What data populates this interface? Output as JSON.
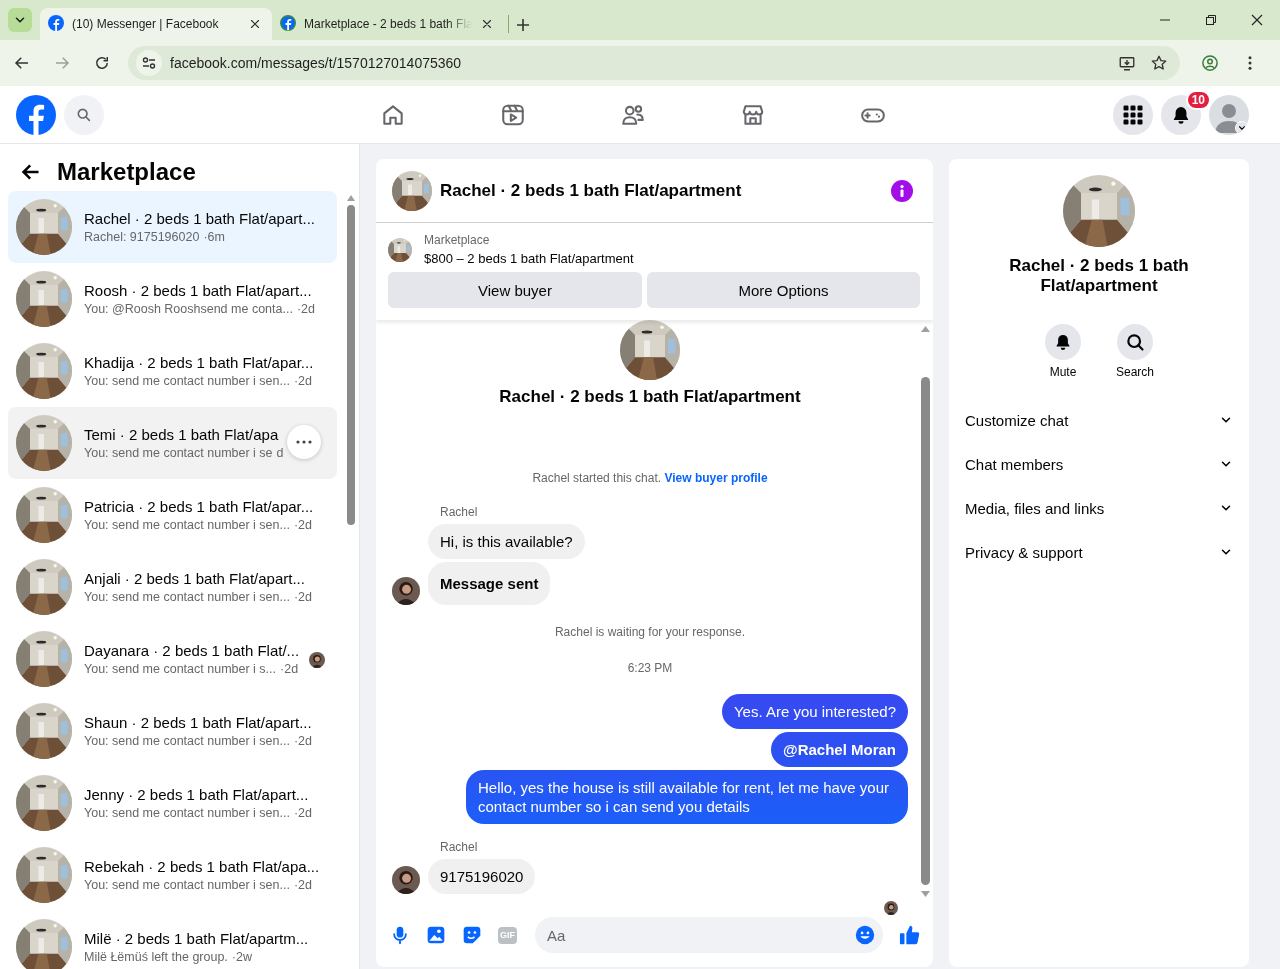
{
  "browser": {
    "tabs": [
      {
        "title": "(10) Messenger | Facebook",
        "selected": true
      },
      {
        "title": "Marketplace - 2 beds 1 bath Fla",
        "selected": false
      }
    ],
    "url": "facebook.com/messages/t/1570127014075360"
  },
  "topbar": {
    "notification_count": "10"
  },
  "sidebar": {
    "title": "Marketplace",
    "conversations": [
      {
        "name": "Rachel · 2 beds 1 bath Flat/apart...",
        "preview": "Rachel: 9175196020",
        "time": "·6m",
        "selected": true,
        "hovered": false,
        "seen": false
      },
      {
        "name": "Roosh · 2 beds 1 bath Flat/apart...",
        "preview": "You: @Roosh Rooshsend me conta...",
        "time": "·2d",
        "selected": false,
        "hovered": false,
        "seen": false
      },
      {
        "name": "Khadija · 2 beds 1 bath Flat/apar...",
        "preview": "You: send me contact number i sen...",
        "time": "·2d",
        "selected": false,
        "hovered": false,
        "seen": false
      },
      {
        "name": "Temi · 2 beds 1 bath Flat/apa",
        "preview": "You: send me contact number i se",
        "time": "d",
        "selected": false,
        "hovered": true,
        "seen": false
      },
      {
        "name": "Patricia · 2 beds 1 bath Flat/apar...",
        "preview": "You: send me contact number i sen...",
        "time": "·2d",
        "selected": false,
        "hovered": false,
        "seen": false
      },
      {
        "name": "Anjali · 2 beds 1 bath Flat/apart...",
        "preview": "You: send me contact number i sen...",
        "time": "·2d",
        "selected": false,
        "hovered": false,
        "seen": false
      },
      {
        "name": "Dayanara · 2 beds 1 bath Flat/...",
        "preview": "You: send me contact number i s...",
        "time": "·2d",
        "selected": false,
        "hovered": false,
        "seen": true
      },
      {
        "name": "Shaun · 2 beds 1 bath Flat/apart...",
        "preview": "You: send me contact number i sen...",
        "time": "·2d",
        "selected": false,
        "hovered": false,
        "seen": false
      },
      {
        "name": "Jenny · 2 beds 1 bath Flat/apart...",
        "preview": "You: send me contact number i sen...",
        "time": "·2d",
        "selected": false,
        "hovered": false,
        "seen": false
      },
      {
        "name": "Rebekah · 2 beds 1 bath Flat/apa...",
        "preview": "You: send me contact number i sen...",
        "time": "·2d",
        "selected": false,
        "hovered": false,
        "seen": false
      },
      {
        "name": "Milë · 2 beds 1 bath Flat/apartm...",
        "preview": "Milë Łëmüś left the group.",
        "time": "·2w",
        "selected": false,
        "hovered": false,
        "seen": false
      }
    ]
  },
  "chat": {
    "title": "Rachel · 2 beds 1 bath Flat/apartment",
    "listing": {
      "label": "Marketplace",
      "title": "$800 – 2 beds 1 bath Flat/apartment"
    },
    "buttons": [
      "View buyer",
      "More Options"
    ],
    "intro_title": "Rachel · 2 beds 1 bath Flat/apartment",
    "messages": [
      {
        "kind": "system",
        "text": "Rachel started this chat.",
        "link": "View buyer profile"
      },
      {
        "kind": "sender",
        "text": "Rachel"
      },
      {
        "kind": "incoming",
        "text": "Hi, is this available?",
        "avatar": false,
        "emphasis": false
      },
      {
        "kind": "incoming",
        "text": "Message sent",
        "avatar": true,
        "emphasis": true
      },
      {
        "kind": "system",
        "text": "Rachel is waiting for your response."
      },
      {
        "kind": "time",
        "text": "6:23 PM"
      },
      {
        "kind": "outgoing",
        "text": "Yes. Are you interested?",
        "emphasis": false
      },
      {
        "kind": "outgoing",
        "text": "@Rachel Moran",
        "emphasis": true
      },
      {
        "kind": "outgoing",
        "text": "Hello, yes the house is still available for rent, let me have your contact number so i can send you details",
        "emphasis": false
      },
      {
        "kind": "sender",
        "text": "Rachel"
      },
      {
        "kind": "incoming",
        "text": "9175196020",
        "avatar": true,
        "emphasis": false
      },
      {
        "kind": "seen"
      }
    ],
    "composer": {
      "placeholder": "Aa",
      "gif_label": "GIF"
    }
  },
  "info": {
    "title": "Rachel · 2 beds 1 bath Flat/apartment",
    "actions": [
      {
        "label": "Mute",
        "kind": "mute"
      },
      {
        "label": "Search",
        "kind": "search"
      }
    ],
    "sections": [
      {
        "label": "Customize chat",
        "expanded": false
      },
      {
        "label": "Chat members",
        "expanded": false
      },
      {
        "label": "Media, files and links",
        "expanded": false
      },
      {
        "label": "Privacy & support",
        "expanded": false
      }
    ]
  }
}
